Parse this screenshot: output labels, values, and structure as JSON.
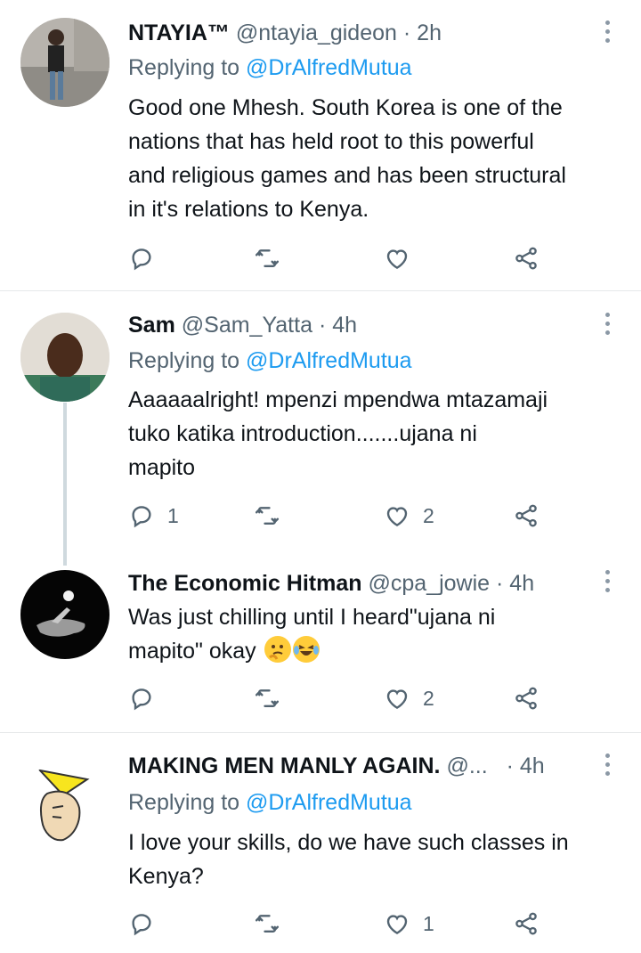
{
  "colors": {
    "accent": "#1d9bf0",
    "secondary_text": "#536471",
    "icon": "#536471"
  },
  "tweets": [
    {
      "name": "NTAYIA™",
      "handle": "@ntayia_gideon",
      "time": "2h",
      "replying_label": "Replying to",
      "replying_to": "@DrAlfredMutua",
      "text_lines": [
        "Good one Mhesh. South Korea is one of the",
        "nations that has held root to this powerful",
        "and religious games and has been structural",
        "in it's relations to Kenya."
      ],
      "reply_count": "",
      "like_count": ""
    },
    {
      "name": "Sam",
      "handle": "@Sam_Yatta",
      "time": "4h",
      "replying_label": "Replying to",
      "replying_to": "@DrAlfredMutua",
      "text_lines": [
        "Aaaaaalright! mpenzi mpendwa mtazamaji",
        "tuko katika introduction.......ujana ni",
        "mapito"
      ],
      "reply_count": "1",
      "like_count": "2"
    },
    {
      "name": "The Economic Hitman",
      "handle": "@cpa_jowie",
      "time": "4h",
      "text_lines": [
        "Was just chilling until I heard\"ujana ni",
        "mapito\" okay"
      ],
      "emojis": [
        "thinking-face",
        "laughing-tears-face"
      ],
      "reply_count": "",
      "like_count": "2"
    },
    {
      "name": "MAKING MEN MANLY AGAIN.",
      "handle": "@...",
      "time": "4h",
      "replying_label": "Replying to",
      "replying_to": "@DrAlfredMutua",
      "text_lines": [
        "I love your skills, do we have such classes in",
        "Kenya?"
      ],
      "reply_count": "",
      "like_count": "1"
    }
  ],
  "separator": "·"
}
